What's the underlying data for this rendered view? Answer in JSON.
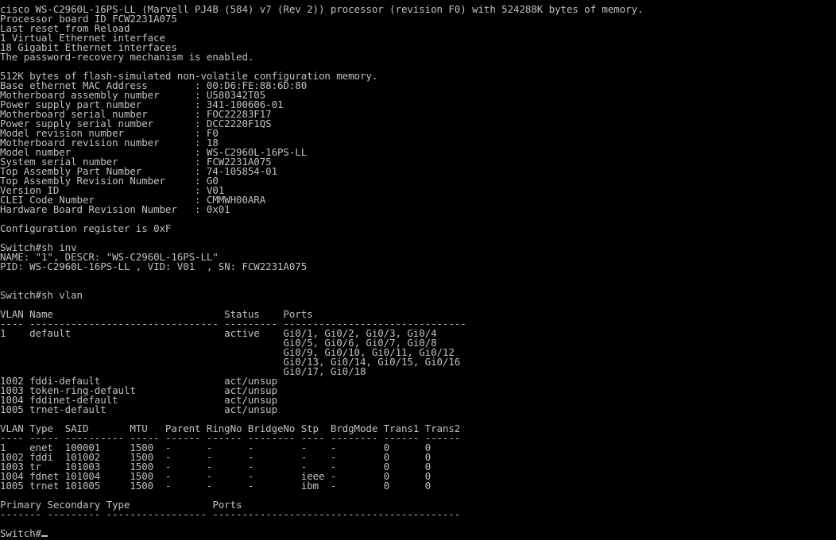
{
  "terminal": {
    "lines": [
      "cisco WS-C2960L-16PS-LL (Marvell PJ4B (584) v7 (Rev 2)) processor (revision F0) with 524288K bytes of memory.",
      "Processor board ID FCW2231A075",
      "Last reset from Reload",
      "1 Virtual Ethernet interface",
      "18 Gigabit Ethernet interfaces",
      "The password-recovery mechanism is enabled.",
      "",
      "512K bytes of flash-simulated non-volatile configuration memory.",
      "Base ethernet MAC Address        : 00:D6:FE:88:6D:80",
      "Motherboard assembly number      : U580342T05",
      "Power supply part number         : 341-100606-01",
      "Motherboard serial number        : FOC22283F17",
      "Power supply serial number       : DCC2220F1QS",
      "Model revision number            : F0",
      "Motherboard revision number      : 18",
      "Model number                     : WS-C2960L-16PS-LL",
      "System serial number             : FCW2231A075",
      "Top Assembly Part Number         : 74-105854-01",
      "Top Assembly Revision Number     : G0",
      "Version ID                       : V01",
      "CLEI Code Number                 : CMMWH00ARA",
      "Hardware Board Revision Number   : 0x01",
      "",
      "Configuration register is 0xF",
      "",
      "Switch#sh inv",
      "NAME: \"1\", DESCR: \"WS-C2960L-16PS-LL\"",
      "PID: WS-C2960L-16PS-LL , VID: V01  , SN: FCW2231A075",
      "",
      "",
      "Switch#sh vlan",
      "",
      "VLAN Name                             Status    Ports",
      "---- -------------------------------- --------- -------------------------------",
      "1    default                          active    Gi0/1, Gi0/2, Gi0/3, Gi0/4",
      "                                                Gi0/5, Gi0/6, Gi0/7, Gi0/8",
      "                                                Gi0/9, Gi0/10, Gi0/11, Gi0/12",
      "                                                Gi0/13, Gi0/14, Gi0/15, Gi0/16",
      "                                                Gi0/17, Gi0/18",
      "1002 fddi-default                     act/unsup",
      "1003 token-ring-default               act/unsup",
      "1004 fddinet-default                  act/unsup",
      "1005 trnet-default                    act/unsup",
      "",
      "VLAN Type  SAID       MTU   Parent RingNo BridgeNo Stp  BrdgMode Trans1 Trans2",
      "---- ----- ---------- ----- ------ ------ -------- ---- -------- ------ ------",
      "1    enet  100001     1500  -      -      -        -    -        0      0",
      "1002 fddi  101002     1500  -      -      -        -    -        0      0",
      "1003 tr    101003     1500  -      -      -        -    -        0      0",
      "1004 fdnet 101004     1500  -      -      -        ieee -        0      0",
      "1005 trnet 101005     1500  -      -      -        ibm  -        0      0",
      "",
      "Primary Secondary Type              Ports",
      "------- --------- ----------------- ------------------------------------------",
      "",
      "Switch#"
    ],
    "colors": {
      "background": "#000000",
      "foreground": "#c0c0c0"
    }
  }
}
